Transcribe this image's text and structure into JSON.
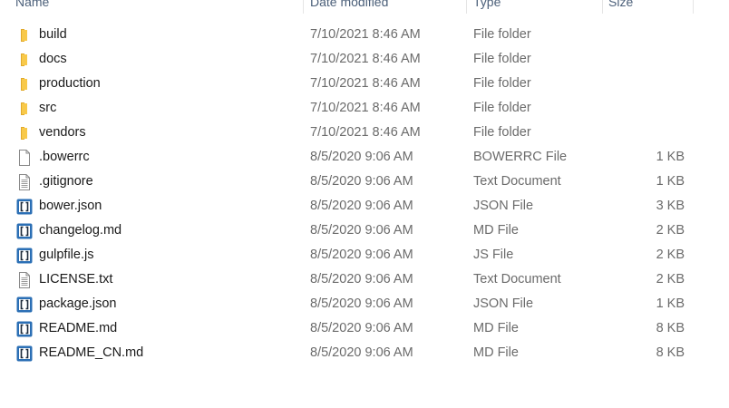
{
  "header": {
    "name": "Name",
    "date": "Date modified",
    "type": "Type",
    "size": "Size"
  },
  "colors": {
    "folder": "#f8c94a",
    "folder_dark": "#e1a92b",
    "json_blue": "#2b6fb5"
  },
  "files": [
    {
      "icon": "folder-icon",
      "name": "build",
      "date": "7/10/2021 8:46 AM",
      "type": "File folder",
      "size": ""
    },
    {
      "icon": "folder-icon",
      "name": "docs",
      "date": "7/10/2021 8:46 AM",
      "type": "File folder",
      "size": ""
    },
    {
      "icon": "folder-icon",
      "name": "production",
      "date": "7/10/2021 8:46 AM",
      "type": "File folder",
      "size": ""
    },
    {
      "icon": "folder-icon",
      "name": "src",
      "date": "7/10/2021 8:46 AM",
      "type": "File folder",
      "size": ""
    },
    {
      "icon": "folder-icon",
      "name": "vendors",
      "date": "7/10/2021 8:46 AM",
      "type": "File folder",
      "size": ""
    },
    {
      "icon": "blank-file-icon",
      "name": ".bowerrc",
      "date": "8/5/2020 9:06 AM",
      "type": "BOWERRC File",
      "size": "1 KB"
    },
    {
      "icon": "text-file-icon",
      "name": ".gitignore",
      "date": "8/5/2020 9:06 AM",
      "type": "Text Document",
      "size": "1 KB"
    },
    {
      "icon": "bracket-file-icon",
      "name": "bower.json",
      "date": "8/5/2020 9:06 AM",
      "type": "JSON File",
      "size": "3 KB"
    },
    {
      "icon": "bracket-file-icon",
      "name": "changelog.md",
      "date": "8/5/2020 9:06 AM",
      "type": "MD File",
      "size": "2 KB"
    },
    {
      "icon": "bracket-file-icon",
      "name": "gulpfile.js",
      "date": "8/5/2020 9:06 AM",
      "type": "JS File",
      "size": "2 KB"
    },
    {
      "icon": "text-file-icon",
      "name": "LICENSE.txt",
      "date": "8/5/2020 9:06 AM",
      "type": "Text Document",
      "size": "2 KB"
    },
    {
      "icon": "bracket-file-icon",
      "name": "package.json",
      "date": "8/5/2020 9:06 AM",
      "type": "JSON File",
      "size": "1 KB"
    },
    {
      "icon": "bracket-file-icon",
      "name": "README.md",
      "date": "8/5/2020 9:06 AM",
      "type": "MD File",
      "size": "8 KB"
    },
    {
      "icon": "bracket-file-icon",
      "name": "README_CN.md",
      "date": "8/5/2020 9:06 AM",
      "type": "MD File",
      "size": "8 KB"
    }
  ]
}
